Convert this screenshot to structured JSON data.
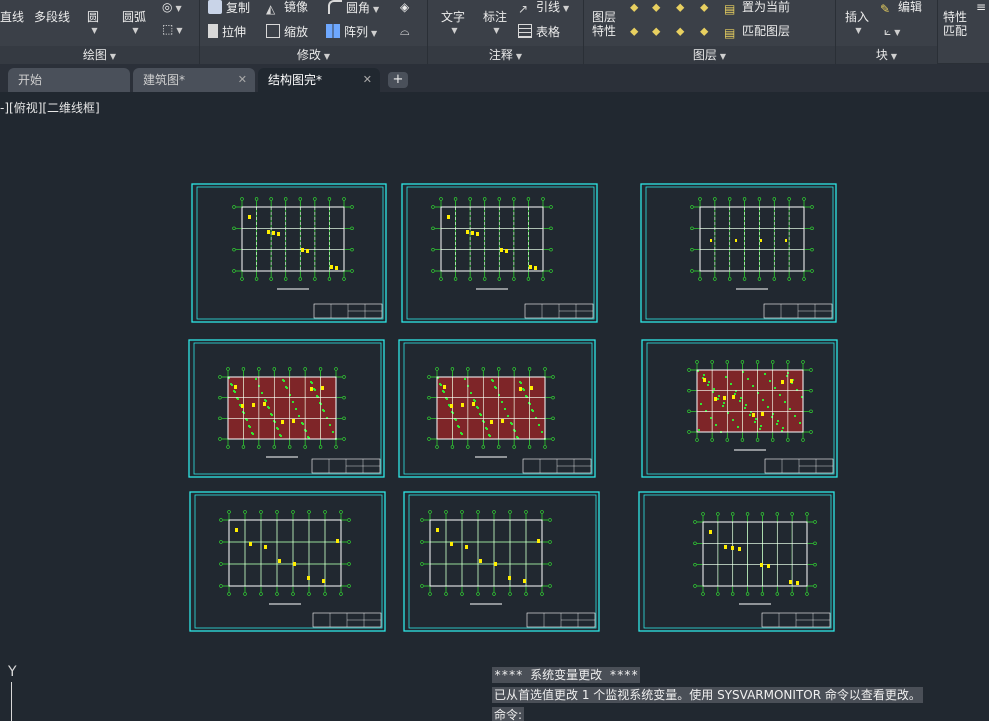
{
  "ribbon": {
    "draw": {
      "line": "直线",
      "polyline": "多段线",
      "circle": "圆",
      "arc": "圆弧",
      "title": "绘图"
    },
    "modify": {
      "copy": "复制",
      "mirror": "镜像",
      "fillet": "圆角",
      "stretch": "拉伸",
      "scale": "缩放",
      "array": "阵列",
      "title": "修改"
    },
    "annotation": {
      "text": "文字",
      "dimension": "标注",
      "leader": "引线",
      "table": "表格",
      "title": "注释"
    },
    "layers": {
      "props_line1": "图层",
      "props_line2": "特性",
      "make_current": "置为当前",
      "match_layer": "匹配图层",
      "title": "图层"
    },
    "block": {
      "insert": "插入",
      "edit": "编辑",
      "title": "块"
    },
    "properties": {
      "match_line1": "特性",
      "match_line2": "匹配"
    }
  },
  "tabs": [
    {
      "label": "开始",
      "closable": false,
      "active": false
    },
    {
      "label": "建筑图*",
      "closable": true,
      "active": false
    },
    {
      "label": "结构图完*",
      "closable": true,
      "active": true
    }
  ],
  "tab_add": "+",
  "viewport": {
    "label": "-][俯视][二维线框]",
    "colors": {
      "frame": "#2ee6e6",
      "grid": "#33e633",
      "wall": "#ffffff",
      "hatch": "#cc2222",
      "accent": "#ffee00"
    }
  },
  "ucs": {
    "axis_label": "Y"
  },
  "command_line": {
    "line1": "**** 系统变量更改 ****",
    "line2": "已从首选值更改 1 个监视系统变量。使用 SYSVARMONITOR 命令以查看更改。",
    "prompt": "命令:"
  }
}
